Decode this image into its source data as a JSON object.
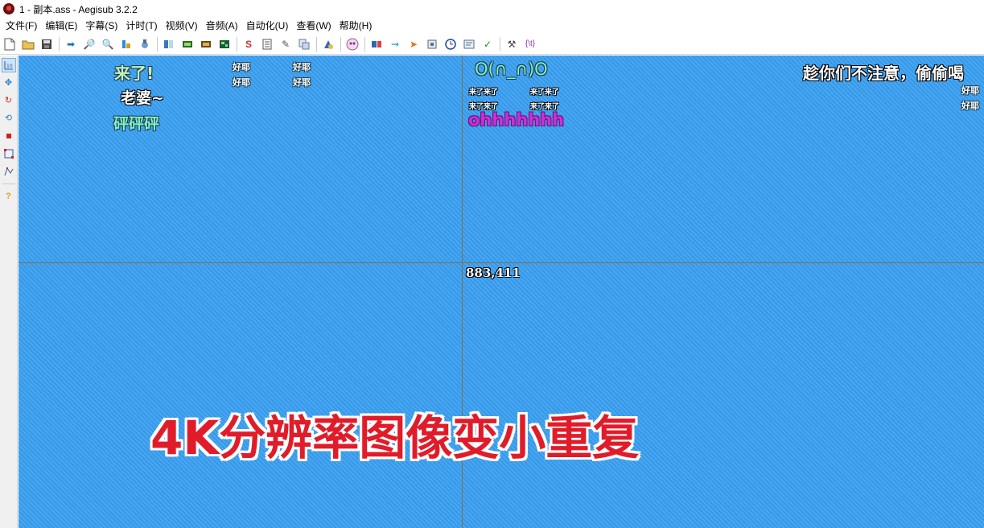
{
  "window": {
    "title": "1 - 副本.ass - Aegisub 3.2.2"
  },
  "menu": {
    "items": [
      "文件(F)",
      "编辑(E)",
      "字幕(S)",
      "计时(T)",
      "视频(V)",
      "音频(A)",
      "自动化(U)",
      "查看(W)",
      "帮助(H)"
    ]
  },
  "toolbar": {
    "icons": [
      "new-file-icon",
      "open-folder-icon",
      "save-icon",
      "jump-to-icon",
      "zoom-in-icon",
      "zoom-out-icon",
      "style-manager-icon",
      "attachments-icon",
      "video-details-icon",
      "keyframes-icon",
      "video-play-icon",
      "video-snap-icon",
      "translation-icon",
      "resample-icon",
      "spellcheck-icon",
      "timing-post-processor-icon",
      "fonts-collector-icon",
      "automation-icon",
      "kanji-timer-icon",
      "shift-times-icon",
      "select-lines-icon",
      "styling-assistant-icon",
      "timer-icon",
      "properties-icon",
      "check-icon",
      "tools-icon",
      "override-tag-icon"
    ]
  },
  "sidetools": {
    "icons": [
      "standard-tool-icon",
      "drag-tool-icon",
      "rotate-z-tool-icon",
      "rotate-xy-tool-icon",
      "scale-tool-icon",
      "clip-tool-icon",
      "vector-clip-tool-icon",
      "help-icon"
    ]
  },
  "video": {
    "coordinate": "883,411",
    "overlay_text": "4K分辨率图像变小重复",
    "colors": {
      "background": "#3aa0f2",
      "crosshair": "#8a6a44",
      "overlay": "#e11c2a"
    },
    "subtitles": {
      "laile": "来了!",
      "laopo": "老婆~",
      "pengpeng": "砰砰砰",
      "haoye": "好耶",
      "face": "O(∩_∩)O",
      "lailele": "来了来了",
      "ohh": "ohhhhhhh",
      "toukan": "趁你们不注意，偷偷喝"
    }
  }
}
